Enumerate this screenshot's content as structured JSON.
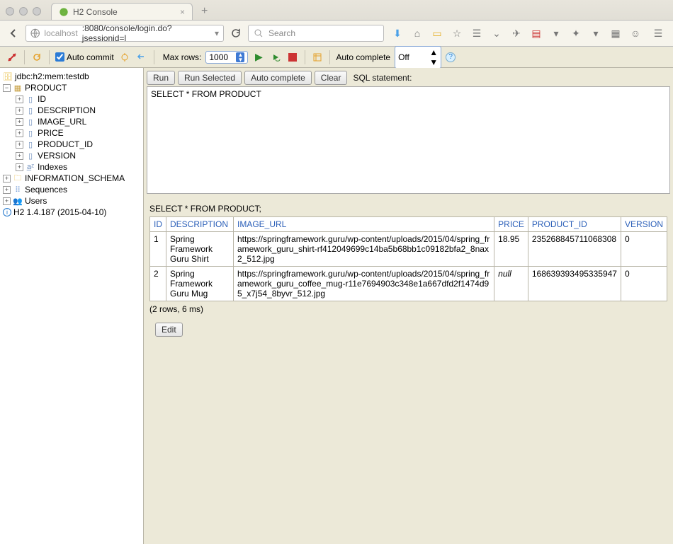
{
  "browser": {
    "tab_title": "H2 Console",
    "url_host": "localhost",
    "url_port_path": ":8080/console/login.do?jsessionid=l",
    "search_placeholder": "Search"
  },
  "h2_toolbar": {
    "auto_commit_label": "Auto commit",
    "max_rows_label": "Max rows:",
    "max_rows_value": "1000",
    "auto_complete_label": "Auto complete",
    "auto_complete_value": "Off"
  },
  "tree": {
    "db": "jdbc:h2:mem:testdb",
    "table": "PRODUCT",
    "columns": [
      "ID",
      "DESCRIPTION",
      "IMAGE_URL",
      "PRICE",
      "PRODUCT_ID",
      "VERSION"
    ],
    "indexes": "Indexes",
    "info_schema": "INFORMATION_SCHEMA",
    "sequences": "Sequences",
    "users": "Users",
    "version": "H2 1.4.187 (2015-04-10)"
  },
  "sql": {
    "run": "Run",
    "run_selected": "Run Selected",
    "auto_complete": "Auto complete",
    "clear": "Clear",
    "stmt_label": "SQL statement:",
    "textarea": "SELECT * FROM PRODUCT"
  },
  "result": {
    "title": "SELECT * FROM PRODUCT;",
    "headers": [
      "ID",
      "DESCRIPTION",
      "IMAGE_URL",
      "PRICE",
      "PRODUCT_ID",
      "VERSION"
    ],
    "rows": [
      {
        "id": "1",
        "desc": "Spring Framework Guru Shirt",
        "img": "https://springframework.guru/wp-content/uploads/2015/04/spring_framework_guru_shirt-rf412049699c14ba5b68bb1c09182bfa2_8nax2_512.jpg",
        "price": "18.95",
        "pid": "235268845711068308",
        "ver": "0"
      },
      {
        "id": "2",
        "desc": "Spring Framework Guru Mug",
        "img": "https://springframework.guru/wp-content/uploads/2015/04/spring_framework_guru_coffee_mug-r11e7694903c348e1a667dfd2f1474d95_x7j54_8byvr_512.jpg",
        "price": "null",
        "pid": "168639393495335947",
        "ver": "0"
      }
    ],
    "summary": "(2 rows, 6 ms)",
    "edit": "Edit"
  }
}
